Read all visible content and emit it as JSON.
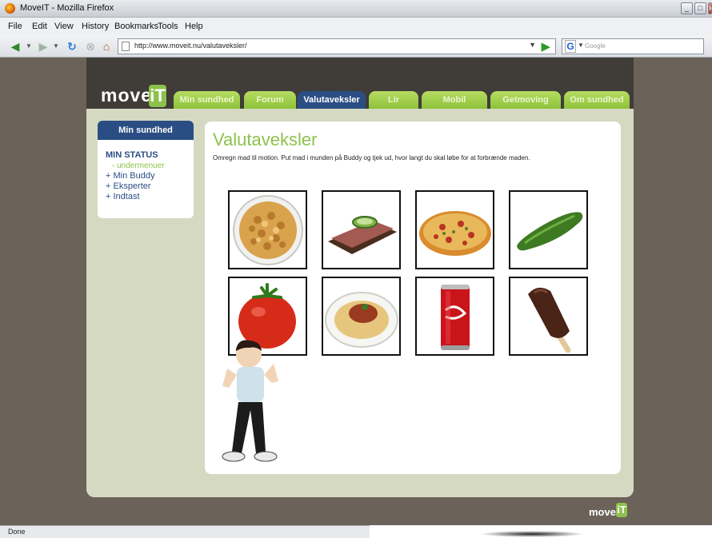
{
  "browser": {
    "title": "MoveIT - Mozilla Firefox",
    "menu": [
      "File",
      "Edit",
      "View",
      "History",
      "Bookmarks",
      "Tools",
      "Help"
    ],
    "url": "http://www.moveit.nu/valutaveksler/",
    "search_placeholder": "Google",
    "status": "Done"
  },
  "site": {
    "logo_text": "move",
    "logo_it": "iT",
    "tabs": [
      "Min sundhed",
      "Forum",
      "Valutaveksler",
      "Lir",
      "Mobil",
      "Getmoving",
      "Om sundhed"
    ],
    "active_tab": "Valutaveksler"
  },
  "sidebar": {
    "title": "Min sundhed",
    "status": "MIN STATUS",
    "submenu": "- undermenuer",
    "links": [
      "+ Min Buddy",
      "+ Eksperter",
      "+ Indtast"
    ]
  },
  "main": {
    "heading": "Valutaveksler",
    "intro": "Omregn mad til motion. Put mad i munden på Buddy og tjek ud, hvor langt du skal løbe for at forbrænde maden.",
    "foods": [
      "cereal-bowl",
      "rye-bread-cucumber",
      "pizza",
      "cucumber",
      "tomato",
      "spaghetti",
      "cola-can",
      "ice-cream-bar"
    ]
  },
  "footer": {
    "logo_text": "move",
    "logo_it": "iT"
  }
}
